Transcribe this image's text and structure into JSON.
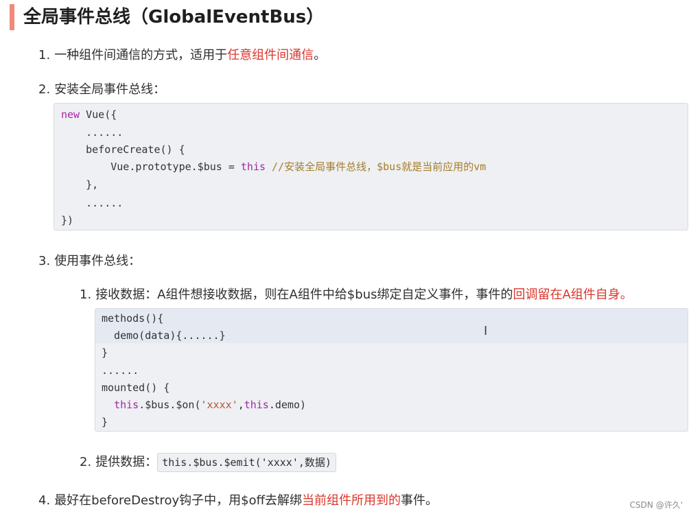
{
  "heading": "全局事件总线（GlobalEventBus）",
  "items": {
    "one": {
      "num": "1.",
      "text": "一种组件间通信的方式，适用于",
      "highlight": "任意组件间通信",
      "tail": "。"
    },
    "two": {
      "num": "2.",
      "text": "安装全局事件总线："
    },
    "three": {
      "num": "3.",
      "text": "使用事件总线："
    },
    "four": {
      "num": "4.",
      "text": "最好在beforeDestroy钩子中，用$off去解绑",
      "highlight": "当前组件所用到的",
      "tail": "事件。"
    }
  },
  "sub": {
    "one": {
      "num": "1.",
      "text": "接收数据：A组件想接收数据，则在A组件中给$bus绑定自定义事件，事件的",
      "highlight": "回调留在A组件自身。"
    },
    "two": {
      "num": "2.",
      "text": "提供数据：",
      "code": "this.$bus.$emit('xxxx',数据)"
    }
  },
  "code_install": {
    "l1_kw": "new",
    "l1_rest": " Vue({",
    "l2": "    ......",
    "l3": "    beforeCreate() {",
    "l4_pre": "        Vue.prototype.$bus = ",
    "l4_kw": "this",
    "l4_comment": " //安装全局事件总线，$bus就是当前应用的vm",
    "l5": "    },",
    "l6": "    ......",
    "l7": "})"
  },
  "code_use": {
    "l1": "methods(){",
    "l2": "  demo(data){......}",
    "l3": "}",
    "l4": "......",
    "l5": "mounted() {",
    "l6_indent": "  ",
    "l6_kw1": "this",
    "l6_mid": ".$bus.$on(",
    "l6_str": "'xxxx'",
    "l6_comma": ",",
    "l6_kw2": "this",
    "l6_end": ".demo)",
    "l7": "}"
  },
  "cursor_glyph": "I",
  "watermark": "CSDN @许久'",
  "colors": {
    "accent_bar": "#f08a7a",
    "highlight_text": "#d9362b",
    "code_bg": "#eef0f3",
    "keyword": "#a626a4",
    "string": "#b5523a",
    "comment": "#a67c2a"
  }
}
